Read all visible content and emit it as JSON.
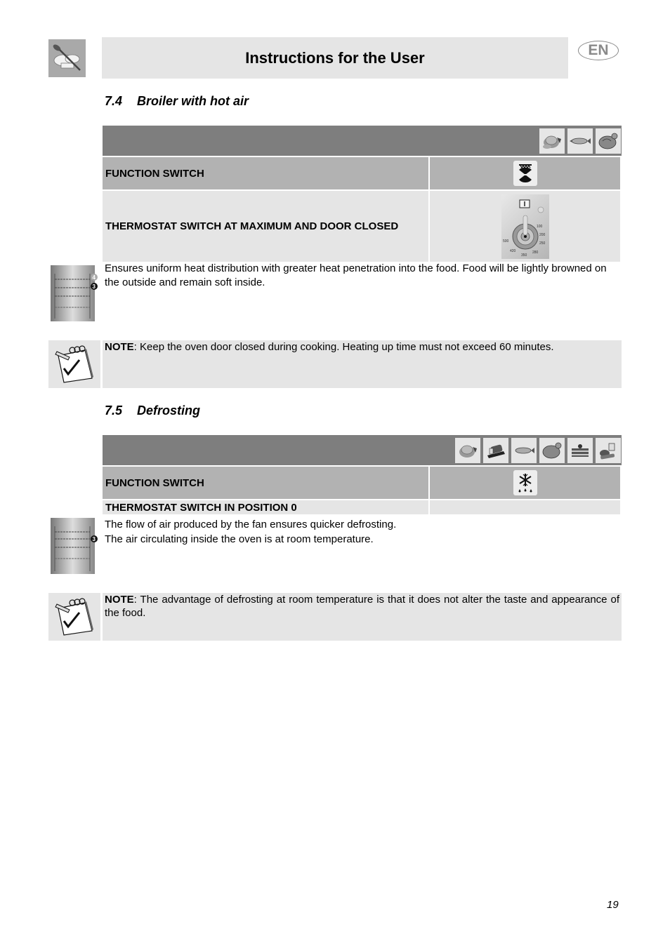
{
  "header": {
    "logo_icon": "chef-hat-spoon-icon",
    "title": "Instructions for the User",
    "language": "EN"
  },
  "sections": [
    {
      "number": "7.4",
      "title": "Broiler with hot air",
      "food_icons": [
        "roast-meat-icon",
        "fish-icon",
        "poultry-icon"
      ],
      "rows": [
        {
          "label": "FUNCTION SWITCH",
          "value_icon": "fan-grill-icon"
        },
        {
          "label": "THERMOSTAT SWITCH AT MAXIMUM AND DOOR CLOSED",
          "value_icon": "thermostat-knob-icon"
        }
      ],
      "shelf_positions": [
        "4",
        "3"
      ],
      "description": "Ensures uniform heat distribution with greater heat penetration into the food. Food will be lightly browned on the outside and remain soft inside.",
      "note": {
        "label": "NOTE",
        "text": ": Keep the oven door closed during cooking. Heating up time must not exceed 60 minutes."
      }
    },
    {
      "number": "7.5",
      "title": "Defrosting",
      "food_icons": [
        "roast-meat-icon",
        "bread-icon",
        "fish-icon",
        "poultry-icon",
        "cake-icon",
        "vegetables-icon"
      ],
      "rows": [
        {
          "label": "FUNCTION SWITCH",
          "value_icon": "defrost-snowflake-icon"
        },
        {
          "label": "THERMOSTAT SWITCH IN POSITION 0",
          "value_icon": ""
        }
      ],
      "shelf_positions": [
        "3"
      ],
      "description_lines": [
        "The flow of air produced by the fan ensures quicker defrosting.",
        "The air circulating inside the oven is at room temperature."
      ],
      "note": {
        "label": "NOTE",
        "text": ": The advantage of defrosting at room temperature is that it does not alter the taste and appearance of the food."
      }
    }
  ],
  "thermostat_scale": [
    "100",
    "200",
    "250",
    "280",
    "350",
    "420",
    "500"
  ],
  "page_number": "19"
}
